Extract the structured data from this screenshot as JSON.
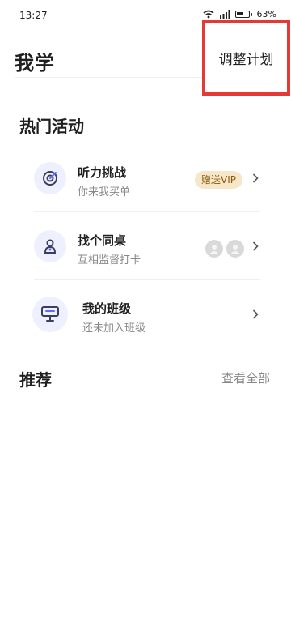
{
  "status_bar": {
    "time": "13:27",
    "battery": "63%"
  },
  "header": {
    "title": "我学",
    "adjust_plan_label": "调整计划"
  },
  "hot_activities": {
    "title": "热门活动",
    "items": [
      {
        "title": "听力挑战",
        "subtitle": "你来我买单",
        "badge": "赠送VIP",
        "icon": "target-icon"
      },
      {
        "title": "找个同桌",
        "subtitle": "互相监督打卡",
        "icon": "deskmate-icon"
      },
      {
        "title": "我的班级",
        "subtitle": "还未加入班级",
        "icon": "classroom-icon"
      }
    ]
  },
  "recommend": {
    "title": "推荐",
    "view_all_label": "查看全部"
  },
  "colors": {
    "highlight_border": "#e53935",
    "badge_bg": "#f5e7c8",
    "icon_bg": "#eef0ff"
  }
}
